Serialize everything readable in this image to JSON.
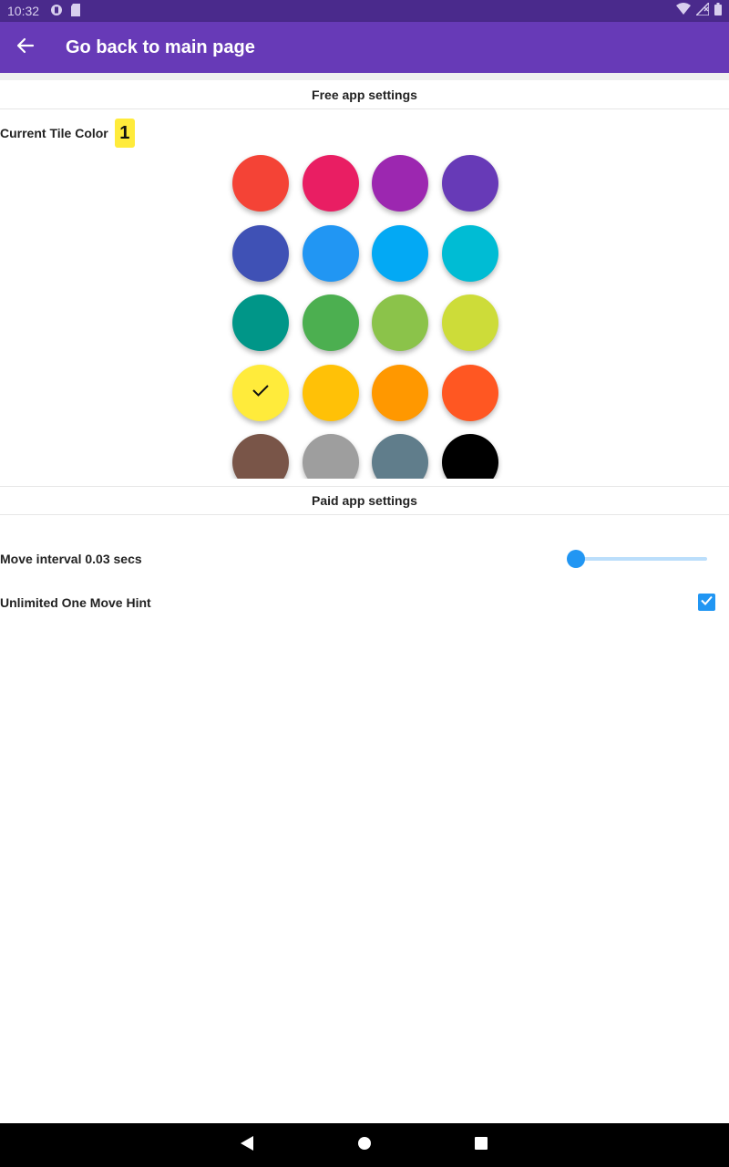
{
  "status_bar": {
    "time": "10:32",
    "left_icons": [
      "fdroid-icon",
      "sd-card-icon"
    ],
    "right_icons": [
      "wifi-icon",
      "signal-icon",
      "battery-icon"
    ]
  },
  "app_bar": {
    "title": "Go back to main page",
    "back_icon": "arrow-back-icon",
    "color": "#673ab7"
  },
  "free_section": {
    "title": "Free app settings",
    "current_color_label": "Current Tile Color",
    "tile_value": "1",
    "selected_index": 12,
    "swatches": [
      {
        "color": "#f44336"
      },
      {
        "color": "#e91e63"
      },
      {
        "color": "#9c27b0"
      },
      {
        "color": "#673ab7"
      },
      {
        "color": "#3f51b5"
      },
      {
        "color": "#2196f3"
      },
      {
        "color": "#03a9f4"
      },
      {
        "color": "#00bcd4"
      },
      {
        "color": "#009688"
      },
      {
        "color": "#4caf50"
      },
      {
        "color": "#8bc34a"
      },
      {
        "color": "#cddc39"
      },
      {
        "color": "#ffeb3b"
      },
      {
        "color": "#ffc107"
      },
      {
        "color": "#ff9800"
      },
      {
        "color": "#ff5722"
      },
      {
        "color": "#795548"
      },
      {
        "color": "#9e9e9e"
      },
      {
        "color": "#607d8b"
      },
      {
        "color": "#000000"
      }
    ]
  },
  "paid_section": {
    "title": "Paid app settings",
    "move_interval_label": "Move interval 0.03 secs",
    "move_interval_fraction": 0.0,
    "hint_label": "Unlimited One Move Hint",
    "hint_checked": true,
    "accent": "#2196f3"
  },
  "nav_bar": {
    "icons": [
      "back-triangle-icon",
      "home-circle-icon",
      "recents-square-icon"
    ]
  }
}
